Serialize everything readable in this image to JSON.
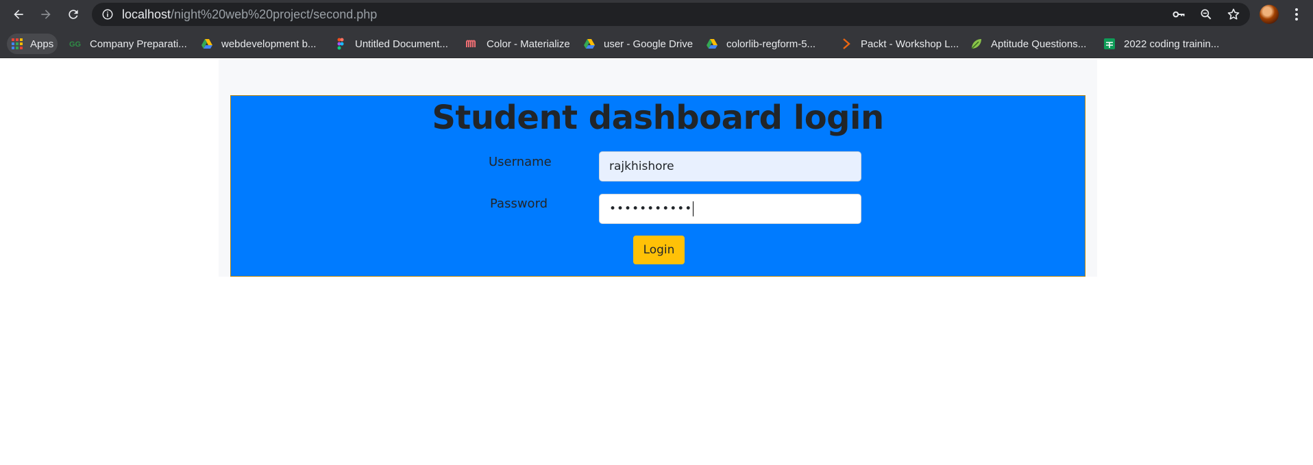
{
  "browser": {
    "url_host": "localhost",
    "url_path": "/night%20web%20project/second.php",
    "icons": [
      "back-icon",
      "forward-icon",
      "reload-icon",
      "info-icon",
      "key-icon",
      "zoom-icon",
      "star-icon",
      "menu-icon"
    ]
  },
  "bookmarks": {
    "apps_label": "Apps",
    "items": [
      {
        "label": "Company Preparati...",
        "icon": "gfg-icon"
      },
      {
        "label": "webdevelopment b...",
        "icon": "drive-icon"
      },
      {
        "label": "Untitled Document...",
        "icon": "figma-icon"
      },
      {
        "label": "Color - Materialize",
        "icon": "materialize-icon"
      },
      {
        "label": "user - Google Drive",
        "icon": "drive-icon"
      },
      {
        "label": "colorlib-regform-5...",
        "icon": "drive-icon"
      },
      {
        "label": "Packt - Workshop L...",
        "icon": "packt-icon"
      },
      {
        "label": "Aptitude Questions...",
        "icon": "leaf-icon"
      },
      {
        "label": "2022 coding trainin...",
        "icon": "sheets-icon"
      }
    ]
  },
  "login": {
    "title": "Student dashboard login",
    "username_label": "Username",
    "username_value": "rajkhishore",
    "password_label": "Password",
    "password_masked": "•••••••••••",
    "button_label": "Login"
  },
  "colors": {
    "card": "#007bff",
    "button": "#ffc107",
    "toolbar": "#35363a"
  }
}
